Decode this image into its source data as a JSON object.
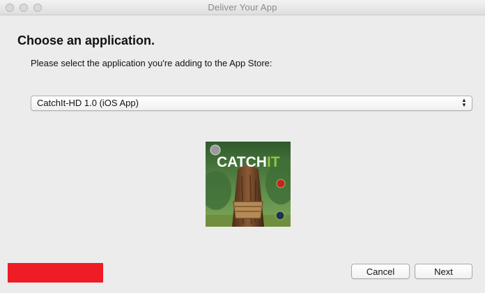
{
  "window": {
    "title": "Deliver Your App"
  },
  "main": {
    "heading": "Choose an application.",
    "subtitle": "Please select the application you're adding to the App Store:"
  },
  "app_select": {
    "selected": "CatchIt-HD 1.0 (iOS App)",
    "arrow_up": "▲",
    "arrow_down": "▼"
  },
  "app_icon": {
    "title_part1": "CATCH",
    "title_part2": "IT",
    "accent_color": "#8dc63f",
    "bg_color": "#3a6a3a"
  },
  "buttons": {
    "cancel": "Cancel",
    "next": "Next"
  },
  "colors": {
    "redaction": "#ee1c25"
  }
}
